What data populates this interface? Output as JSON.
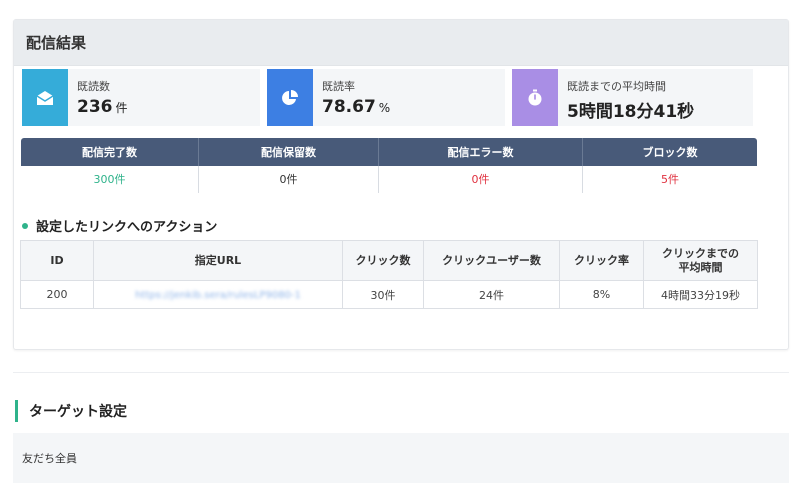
{
  "delivery_result": {
    "title": "配信結果",
    "stats": [
      {
        "label": "既読数",
        "value": "236",
        "unit": "件",
        "icon": "envelope-open-icon",
        "color": "#35acd9"
      },
      {
        "label": "既読率",
        "value": "78.67",
        "unit": "%",
        "icon": "pie-chart-icon",
        "color": "#3d7fe3"
      },
      {
        "label": "既読までの平均時間",
        "value": "5時間18分41秒",
        "unit": "",
        "icon": "stopwatch-icon",
        "color": "#a98ee5"
      }
    ],
    "summary": {
      "headers": [
        "配信完了数",
        "配信保留数",
        "配信エラー数",
        "ブロック数"
      ],
      "values": [
        "300件",
        "0件",
        "0件",
        "5件"
      ]
    },
    "link_section_title": "設定したリンクへのアクション",
    "link_table": {
      "headers": [
        "ID",
        "指定URL",
        "クリック数",
        "クリックユーザー数",
        "クリック率",
        "クリックまでの\n平均時間"
      ],
      "header_last_line1": "クリックまでの",
      "header_last_line2": "平均時間",
      "rows": [
        {
          "id": "200",
          "url": "https://jenkib.sera/rulesLP9080-1",
          "clicks": "30件",
          "users": "24件",
          "rate": "8%",
          "avg_time": "4時間33分19秒"
        }
      ]
    }
  },
  "target": {
    "title": "ターゲット設定",
    "value": "友だち全員"
  },
  "colors": {
    "accent_green": "#2fb38b",
    "error_red": "#e0313f",
    "table_header": "#485a79"
  }
}
